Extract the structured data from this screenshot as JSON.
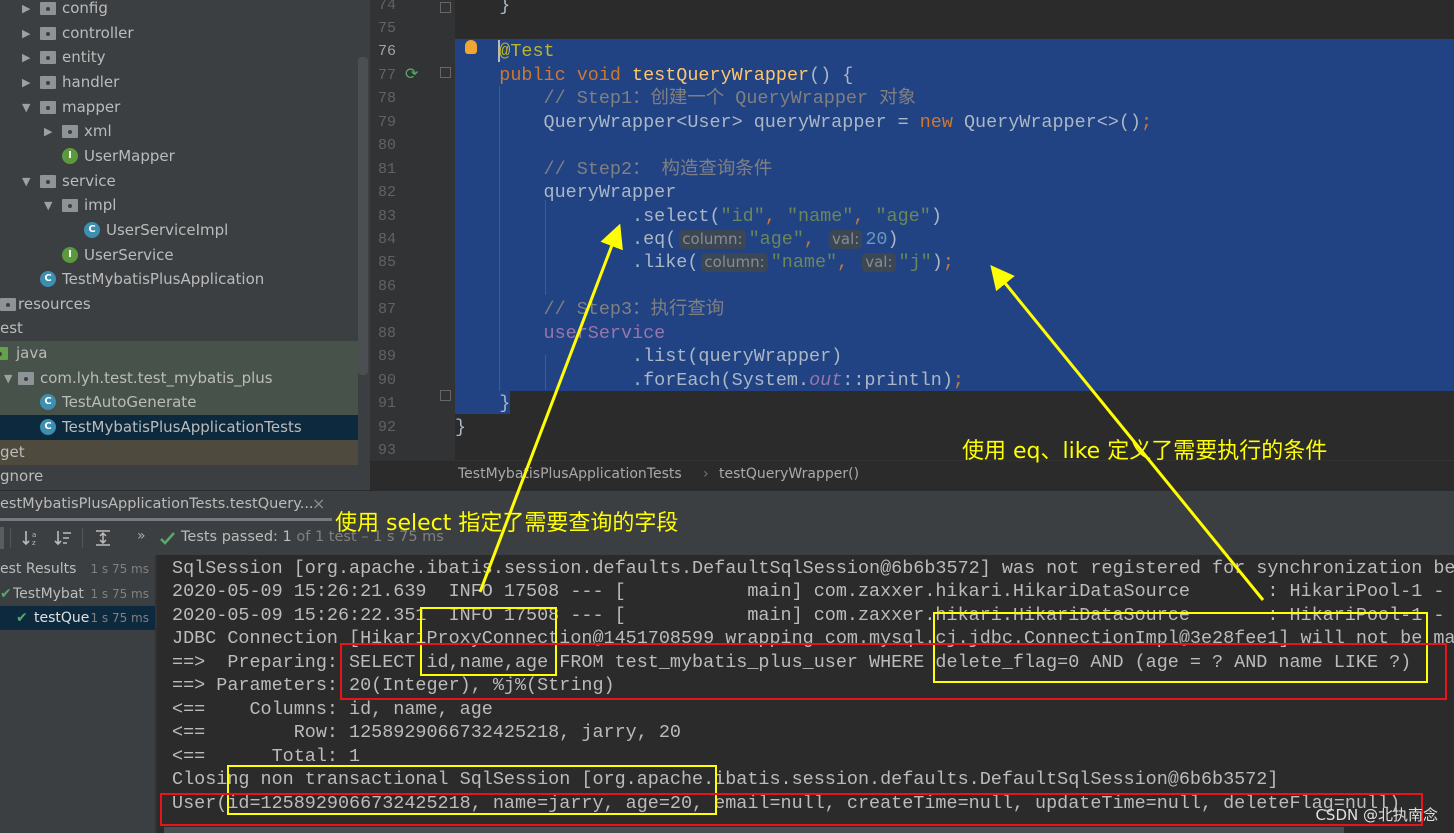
{
  "project_tree": [
    {
      "label": "config",
      "type": "folder",
      "state": "collapsed"
    },
    {
      "label": "controller",
      "type": "folder",
      "state": "collapsed"
    },
    {
      "label": "entity",
      "type": "folder",
      "state": "collapsed"
    },
    {
      "label": "handler",
      "type": "folder",
      "state": "collapsed"
    },
    {
      "label": "mapper",
      "type": "folder",
      "state": "expanded"
    },
    {
      "label": "xml",
      "type": "folder",
      "state": "collapsed"
    },
    {
      "label": "UserMapper",
      "type": "interface"
    },
    {
      "label": "service",
      "type": "folder",
      "state": "expanded"
    },
    {
      "label": "impl",
      "type": "folder",
      "state": "expanded"
    },
    {
      "label": "UserServiceImpl",
      "type": "class"
    },
    {
      "label": "UserService",
      "type": "interface"
    },
    {
      "label": "TestMybatisPlusApplication",
      "type": "spring-class"
    },
    {
      "label": "resources",
      "type": "resources-folder"
    },
    {
      "label": "est",
      "type": "text"
    },
    {
      "label": "java",
      "type": "test-folder"
    },
    {
      "label": "com.lyh.test.test_mybatis_plus",
      "type": "folder",
      "state": "expanded"
    },
    {
      "label": "TestAutoGenerate",
      "type": "test-class"
    },
    {
      "label": "TestMybatisPlusApplicationTests",
      "type": "test-class",
      "selected": true
    },
    {
      "label": "get",
      "type": "text"
    },
    {
      "label": "gnore",
      "type": "text"
    }
  ],
  "editor": {
    "line_numbers": [
      "74",
      "75",
      "76",
      "77",
      "78",
      "79",
      "80",
      "81",
      "82",
      "83",
      "84",
      "85",
      "86",
      "87",
      "88",
      "89",
      "90",
      "91",
      "92",
      "93"
    ],
    "lines": [
      [
        [
          "    }",
          "p"
        ]
      ],
      [],
      [
        [
          "    ",
          "p"
        ],
        [
          "@Test",
          "ann"
        ]
      ],
      [
        [
          "    ",
          "p"
        ],
        [
          "public void ",
          "kw"
        ],
        [
          "testQueryWrapper",
          "fn"
        ],
        [
          "() {",
          "p"
        ]
      ],
      [
        [
          "        // Step1：创建一个 QueryWrapper 对象",
          "cm"
        ]
      ],
      [
        [
          "        QueryWrapper<User> queryWrapper = ",
          "p"
        ],
        [
          "new",
          "kw"
        ],
        [
          " QueryWrapper<>()",
          "p"
        ],
        [
          ";",
          "kw"
        ]
      ],
      [],
      [
        [
          "        // Step2： 构造查询条件",
          "cm"
        ]
      ],
      [
        [
          "        queryWrapper",
          "p"
        ]
      ],
      [
        [
          "                .select(",
          "p"
        ],
        [
          "\"id\"",
          "str"
        ],
        [
          ", ",
          "kw"
        ],
        [
          "\"name\"",
          "str"
        ],
        [
          ", ",
          "kw"
        ],
        [
          "\"age\"",
          "str"
        ],
        [
          ")",
          "p"
        ]
      ],
      [
        [
          "                .eq(",
          "p"
        ],
        [
          "column:",
          "hint"
        ],
        [
          "\"age\"",
          "str"
        ],
        [
          ", ",
          "kw"
        ],
        [
          "val:",
          "hint"
        ],
        [
          "20",
          "num"
        ],
        [
          ")",
          "p"
        ]
      ],
      [
        [
          "                .like(",
          "p"
        ],
        [
          "column:",
          "hint"
        ],
        [
          "\"name\"",
          "str"
        ],
        [
          ", ",
          "kw"
        ],
        [
          "val:",
          "hint"
        ],
        [
          "\"j\"",
          "str"
        ],
        [
          ")",
          "p"
        ],
        [
          ";",
          "kw"
        ]
      ],
      [],
      [
        [
          "        // Step3：执行查询",
          "cm"
        ]
      ],
      [
        [
          "        userService",
          "fld"
        ]
      ],
      [
        [
          "                .list(queryWrapper)",
          "p"
        ]
      ],
      [
        [
          "                .forEach(System.",
          "p"
        ],
        [
          "out",
          "it"
        ],
        [
          "::println)",
          "p"
        ],
        [
          ";",
          "kw"
        ]
      ],
      [
        [
          "    }",
          "p"
        ]
      ],
      [
        [
          "}",
          "p"
        ]
      ],
      []
    ]
  },
  "breadcrumb": {
    "class": "TestMybatisPlusApplicationTests",
    "separator": "›",
    "method": "testQueryWrapper()"
  },
  "run_tab": {
    "label": "estMybatisPlusApplicationTests.testQuery...",
    "close": "×"
  },
  "toolbar": {
    "more": "»",
    "status_bold": "Tests passed: 1",
    "status_rest": " of 1 test – 1 s 75 ms"
  },
  "test_results": [
    {
      "label": "est Results",
      "time": "1 s 75 ms"
    },
    {
      "label": "TestMybat",
      "time": "1 s 75 ms",
      "passed": true
    },
    {
      "label": "testQue",
      "time": "1 s 75 ms",
      "passed": true,
      "selected": true
    }
  ],
  "console": [
    "SqlSession [org.apache.ibatis.session.defaults.DefaultSqlSession@6b6b3572] was not registered for synchronization be",
    "2020-05-09 15:26:21.639  INFO 17508 --- [           main] com.zaxxer.hikari.HikariDataSource       : HikariPool-1 - ",
    "2020-05-09 15:26:22.351  INFO 17508 --- [           main] com.zaxxer.hikari.HikariDataSource       : HikariPool-1 - ",
    "JDBC Connection [HikariProxyConnection@1451708599 wrapping com.mysql.cj.jdbc.ConnectionImpl@3e28fee1] will not be ma",
    "==>  Preparing: SELECT id,name,age FROM test_mybatis_plus_user WHERE delete_flag=0 AND (age = ? AND name LIKE ?)",
    "==> Parameters: 20(Integer), %j%(String)",
    "<==    Columns: id, name, age",
    "<==        Row: 1258929066732425218, jarry, 20",
    "<==      Total: 1",
    "Closing non transactional SqlSession [org.apache.ibatis.session.defaults.DefaultSqlSession@6b6b3572]",
    "User(id=1258929066732425218, name=jarry, age=20, email=null, createTime=null, updateTime=null, deleteFlag=null)"
  ],
  "annotations": {
    "select_note": "使用 select 指定了需要查询的字段",
    "condition_note": "使用 eq、like 定义了需要执行的条件",
    "highlight_color": "#ffff00",
    "box_color": "#e8141b"
  },
  "watermark": "CSDN @北执南念"
}
